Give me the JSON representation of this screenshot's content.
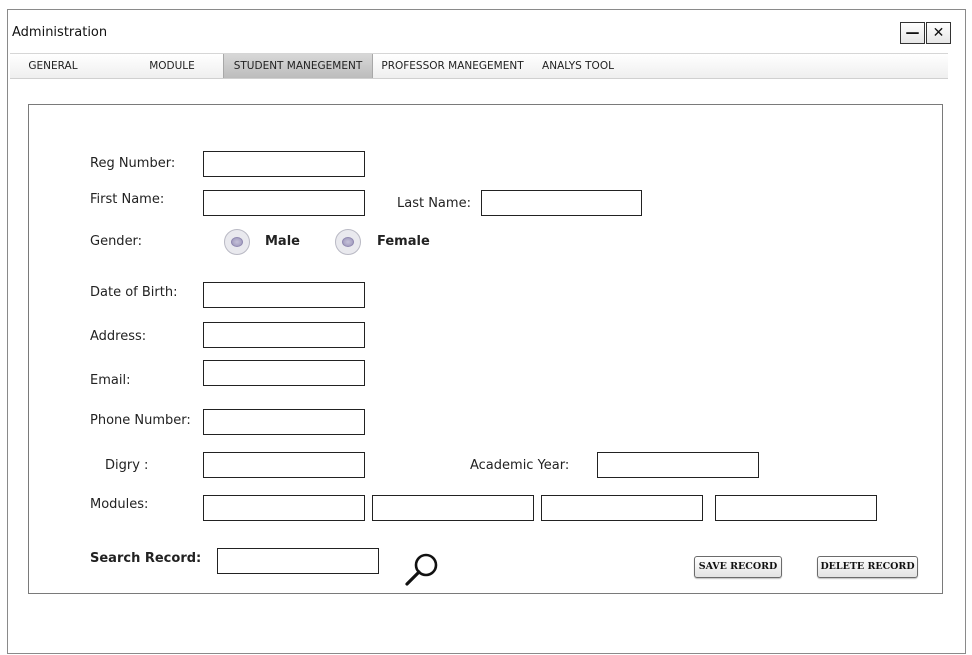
{
  "window": {
    "title": "Administration",
    "minimize_glyph": "—",
    "close_glyph": "✕"
  },
  "tabs": [
    {
      "label": "GENERAL",
      "active": false
    },
    {
      "label": "MODULE",
      "active": false
    },
    {
      "label": "STUDENT MANEGEMENT",
      "active": true
    },
    {
      "label": "PROFESSOR MANEGEMENT",
      "active": false
    },
    {
      "label": "ANALYS TOOL",
      "active": false
    }
  ],
  "form": {
    "reg_number": {
      "label": "Reg Number:",
      "value": ""
    },
    "first_name": {
      "label": "First Name:",
      "value": ""
    },
    "last_name": {
      "label": "Last Name:",
      "value": ""
    },
    "gender": {
      "label": "Gender:",
      "options": [
        "Male",
        "Female"
      ],
      "selected": ""
    },
    "date_of_birth": {
      "label": "Date of Birth:",
      "value": ""
    },
    "address": {
      "label": "Address:",
      "value": ""
    },
    "email": {
      "label": "Email:",
      "value": ""
    },
    "phone_number": {
      "label": "Phone Number:",
      "value": ""
    },
    "digry": {
      "label": "Digry :",
      "value": ""
    },
    "academic_year": {
      "label": "Academic Year:",
      "value": ""
    },
    "modules": {
      "label": "Modules:",
      "values": [
        "",
        "",
        "",
        ""
      ]
    },
    "search_record": {
      "label": "Search Record:",
      "value": ""
    }
  },
  "buttons": {
    "save": "SAVE RECORD",
    "delete": "DELETE RECORD"
  },
  "colors": {
    "active_tab": "#c4c4c4",
    "radio_dot": "#a9a3c4"
  },
  "icons": {
    "search": "magnifier-icon"
  }
}
